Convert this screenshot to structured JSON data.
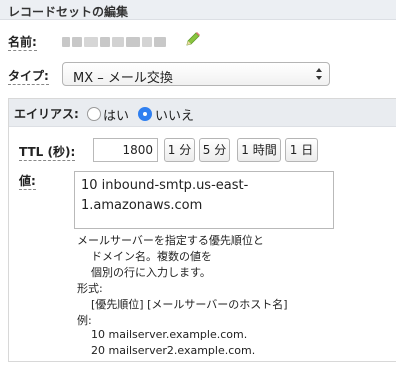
{
  "header": {
    "title": "レコードセットの編集"
  },
  "name_field": {
    "label": "名前:"
  },
  "type_field": {
    "label": "タイプ:",
    "selected": "MX – メール交換"
  },
  "alias": {
    "label": "エイリアス:",
    "options": [
      {
        "label": "はい",
        "selected": false
      },
      {
        "label": "いいえ",
        "selected": true
      }
    ]
  },
  "ttl": {
    "label": "TTL (秒):",
    "value": "1800",
    "buttons": [
      "1 分",
      "5 分",
      "1 時間",
      "1 日"
    ]
  },
  "value_field": {
    "label": "値:",
    "lines": [
      "10 inbound-smtp.us-east-",
      "1.amazonaws.com"
    ]
  },
  "help": {
    "lines": [
      "メールサーバーを指定する優先順位と",
      "ドメイン名。複数の値を",
      "個別の行に入力します。",
      "形式:",
      "[優先順位] [メールサーバーのホスト名]",
      "例:",
      "10 mailserver.example.com.",
      "20 mailserver2.example.com."
    ]
  },
  "icons": {
    "edit": "pencil-icon",
    "select": "select-arrows-icon"
  },
  "colors": {
    "header_bg": "#eceff3",
    "radio_selected": "#2f7ff0",
    "pencil": "#7cc043"
  }
}
